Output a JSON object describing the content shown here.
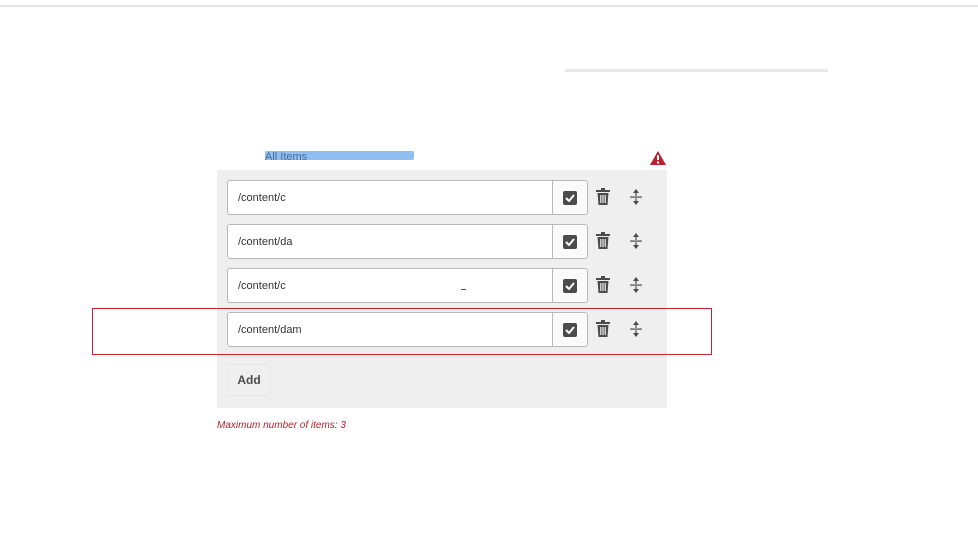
{
  "field": {
    "label": "All Items",
    "alert_color": "#b4222e"
  },
  "items": [
    {
      "value": "/content/c"
    },
    {
      "value": "/content/da"
    },
    {
      "value": "/content/c"
    },
    {
      "value": "/content/dam"
    }
  ],
  "add_label": "Add",
  "error_message": "Maximum number of items: 3",
  "icons": {
    "picker": "checkbox-icon",
    "delete": "trash-icon",
    "reorder": "reorder-icon",
    "alert": "alert-triangle-icon"
  }
}
